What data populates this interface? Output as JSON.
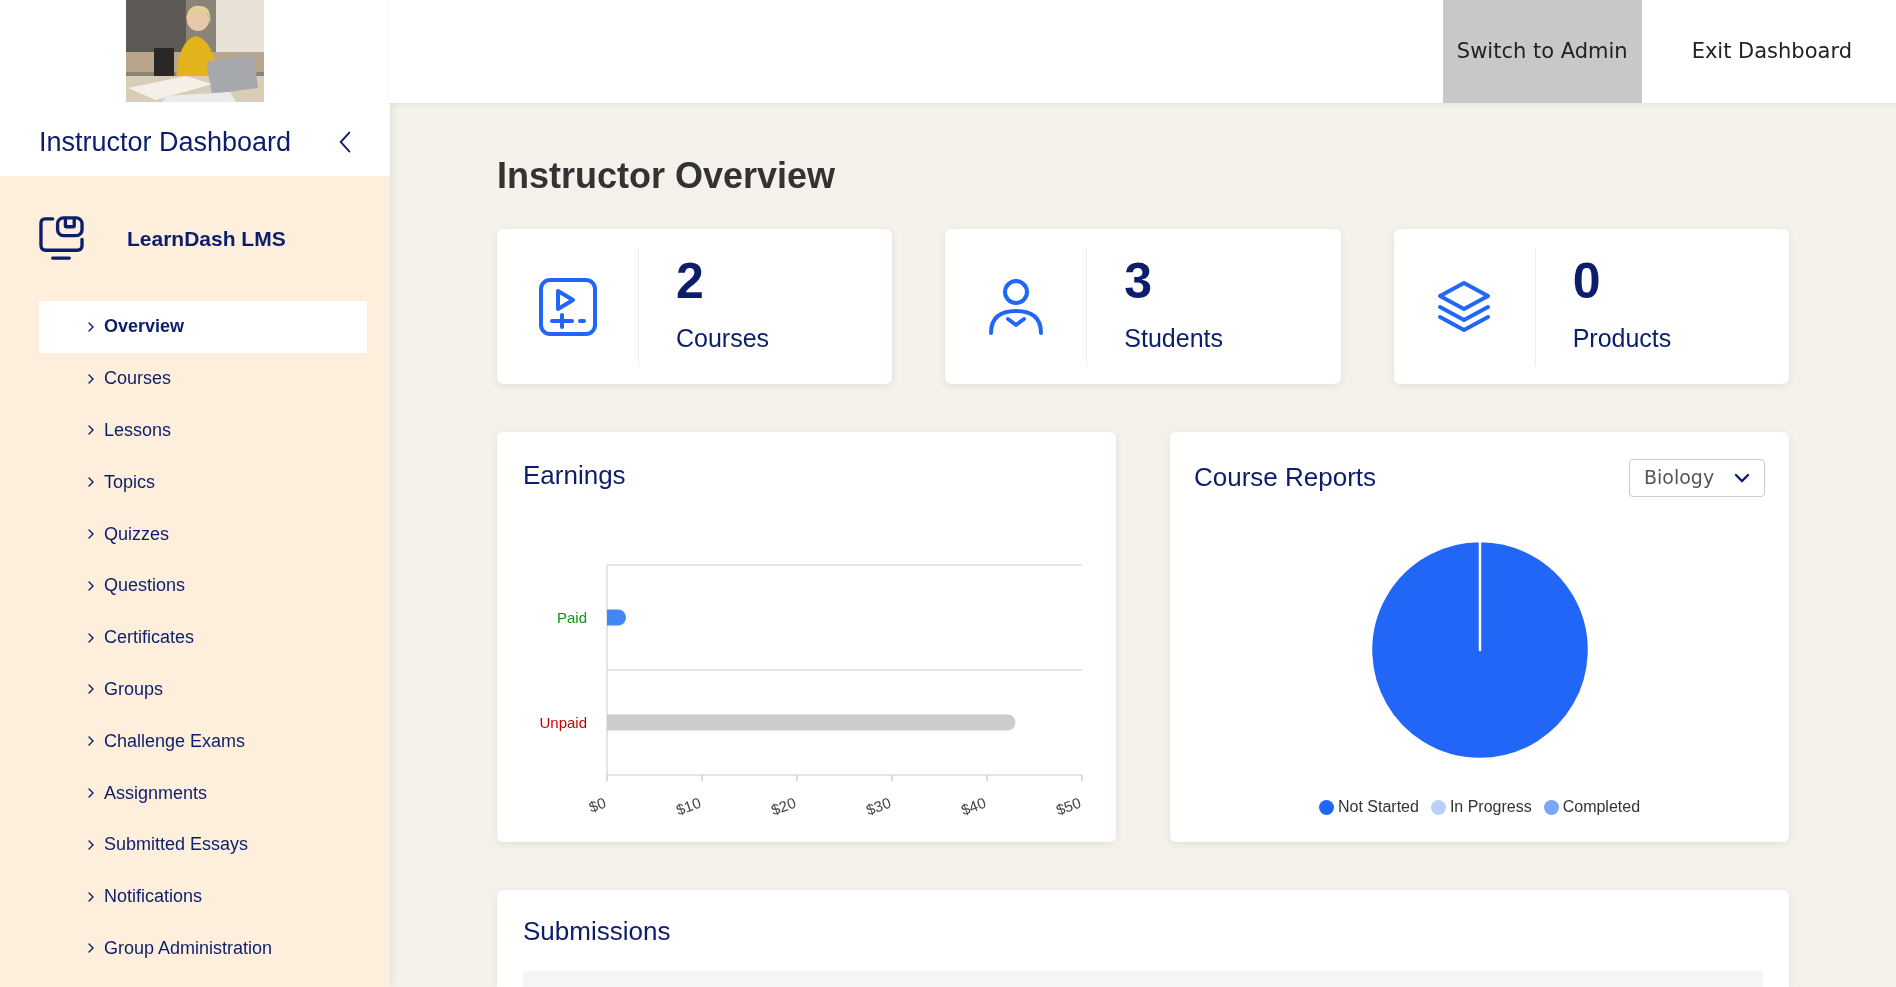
{
  "top_bar": {
    "buttons": [
      {
        "label": "Switch to Admin",
        "selected": true
      },
      {
        "label": "Exit Dashboard",
        "selected": false
      }
    ]
  },
  "sidebar": {
    "title": "Instructor Dashboard",
    "brand": "LearnDash LMS",
    "items": [
      {
        "label": "Overview",
        "selected": true
      },
      {
        "label": "Courses",
        "selected": false
      },
      {
        "label": "Lessons",
        "selected": false
      },
      {
        "label": "Topics",
        "selected": false
      },
      {
        "label": "Quizzes",
        "selected": false
      },
      {
        "label": "Questions",
        "selected": false
      },
      {
        "label": "Certificates",
        "selected": false
      },
      {
        "label": "Groups",
        "selected": false
      },
      {
        "label": "Challenge Exams",
        "selected": false
      },
      {
        "label": "Assignments",
        "selected": false
      },
      {
        "label": "Submitted Essays",
        "selected": false
      },
      {
        "label": "Notifications",
        "selected": false
      },
      {
        "label": "Group Administration",
        "selected": false
      }
    ]
  },
  "page_title": "Instructor Overview",
  "stats": [
    {
      "kind": "courses",
      "value": "2",
      "label": "Courses"
    },
    {
      "kind": "students",
      "value": "3",
      "label": "Students"
    },
    {
      "kind": "products",
      "value": "0",
      "label": "Products"
    }
  ],
  "earnings": {
    "title": "Earnings",
    "chart_data": {
      "type": "bar",
      "orientation": "horizontal",
      "categories": [
        "Paid",
        "Unpaid"
      ],
      "colors": [
        "#4285f4",
        "#cccccc"
      ],
      "values": [
        2,
        43
      ],
      "xlim": [
        0,
        50
      ],
      "xticks": [
        {
          "value": 0,
          "label": "$0"
        },
        {
          "value": 10,
          "label": "$10"
        },
        {
          "value": 20,
          "label": "$20"
        },
        {
          "value": 30,
          "label": "$30"
        },
        {
          "value": 40,
          "label": "$40"
        },
        {
          "value": 50,
          "label": "$50"
        }
      ]
    }
  },
  "course_reports": {
    "title": "Course Reports",
    "dropdown": {
      "value": "Biology"
    },
    "chart_data": {
      "type": "pie",
      "categories": [
        "Not Started",
        "In Progress",
        "Completed"
      ],
      "colors": [
        "#2166f7",
        "#b9d0fb",
        "#7ca4f8"
      ],
      "values": [
        1,
        0,
        0
      ]
    }
  },
  "submissions": {
    "title": "Submissions"
  }
}
